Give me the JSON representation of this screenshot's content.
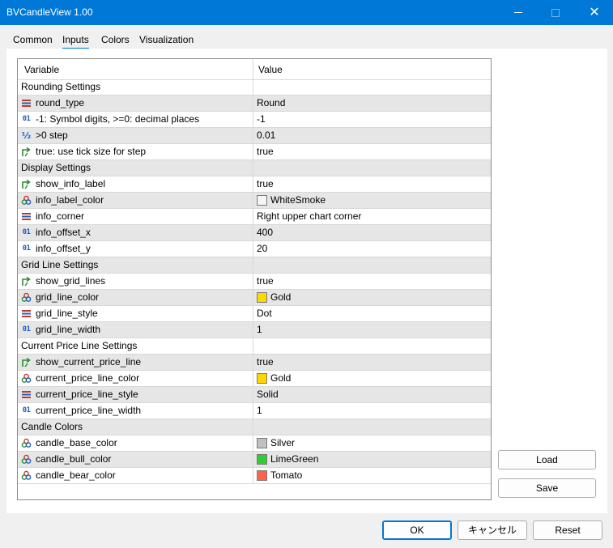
{
  "window": {
    "title": "BVCandleView 1.00"
  },
  "tabs": [
    {
      "label": "Common"
    },
    {
      "label": "Inputs"
    },
    {
      "label": "Colors"
    },
    {
      "label": "Visualization"
    }
  ],
  "grid": {
    "headers": {
      "variable": "Variable",
      "value": "Value"
    },
    "rows": [
      {
        "kind": "section",
        "label": "Rounding Settings"
      },
      {
        "kind": "param",
        "icon": "enum",
        "variable": "round_type",
        "value": "Round"
      },
      {
        "kind": "param",
        "icon": "int",
        "variable": "-1: Symbol digits, >=0: decimal places",
        "value": "-1"
      },
      {
        "kind": "param",
        "icon": "double",
        "variable": ">0 step",
        "value": "0.01"
      },
      {
        "kind": "param",
        "icon": "bool",
        "variable": "true: use tick size for step",
        "value": "true"
      },
      {
        "kind": "section",
        "label": "Display Settings"
      },
      {
        "kind": "param",
        "icon": "bool",
        "variable": "show_info_label",
        "value": "true"
      },
      {
        "kind": "param",
        "icon": "color",
        "variable": "info_label_color",
        "value": "WhiteSmoke",
        "swatch": "#f5f5f5"
      },
      {
        "kind": "param",
        "icon": "enum",
        "variable": "info_corner",
        "value": "Right upper chart corner"
      },
      {
        "kind": "param",
        "icon": "int",
        "variable": "info_offset_x",
        "value": "400"
      },
      {
        "kind": "param",
        "icon": "int",
        "variable": "info_offset_y",
        "value": "20"
      },
      {
        "kind": "section",
        "label": "Grid Line Settings"
      },
      {
        "kind": "param",
        "icon": "bool",
        "variable": "show_grid_lines",
        "value": "true"
      },
      {
        "kind": "param",
        "icon": "color",
        "variable": "grid_line_color",
        "value": "Gold",
        "swatch": "#ffd700"
      },
      {
        "kind": "param",
        "icon": "enum",
        "variable": "grid_line_style",
        "value": "Dot"
      },
      {
        "kind": "param",
        "icon": "int",
        "variable": "grid_line_width",
        "value": "1"
      },
      {
        "kind": "section",
        "label": "Current Price Line Settings"
      },
      {
        "kind": "param",
        "icon": "bool",
        "variable": "show_current_price_line",
        "value": "true"
      },
      {
        "kind": "param",
        "icon": "color",
        "variable": "current_price_line_color",
        "value": "Gold",
        "swatch": "#ffd700"
      },
      {
        "kind": "param",
        "icon": "enum",
        "variable": "current_price_line_style",
        "value": "Solid"
      },
      {
        "kind": "param",
        "icon": "int",
        "variable": "current_price_line_width",
        "value": "1"
      },
      {
        "kind": "section",
        "label": "Candle Colors"
      },
      {
        "kind": "param",
        "icon": "color",
        "variable": "candle_base_color",
        "value": "Silver",
        "swatch": "#c0c0c0"
      },
      {
        "kind": "param",
        "icon": "color",
        "variable": "candle_bull_color",
        "value": "LimeGreen",
        "swatch": "#32cd32"
      },
      {
        "kind": "param",
        "icon": "color",
        "variable": "candle_bear_color",
        "value": "Tomato",
        "swatch": "#ff6347"
      }
    ]
  },
  "buttons": {
    "load": "Load",
    "save": "Save",
    "ok": "OK",
    "cancel": "キャンセル",
    "reset": "Reset"
  },
  "icon_text": {
    "int": "01",
    "double": "½"
  },
  "colors": {
    "titlebar": "#0078d7",
    "accent": "#0078d7",
    "row_alt": "#e6e6e6"
  }
}
